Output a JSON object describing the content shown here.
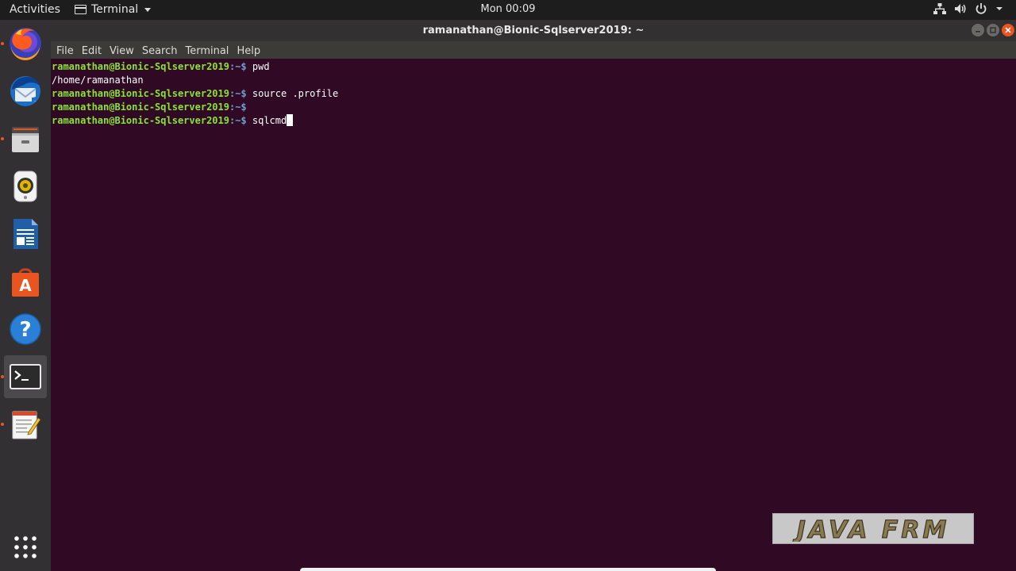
{
  "topbar": {
    "activities_label": "Activities",
    "app_name": "Terminal",
    "clock": "Mon 00:09",
    "icons": [
      "network-icon",
      "volume-icon",
      "power-icon",
      "system-menu-caret-icon"
    ]
  },
  "dock": {
    "items": [
      {
        "name": "firefox",
        "icon": "firefox-icon",
        "running": true
      },
      {
        "name": "thunderbird",
        "icon": "thunderbird-mail-icon",
        "running": false
      },
      {
        "name": "files",
        "icon": "files-cabinet-icon",
        "running": true
      },
      {
        "name": "rhythmbox",
        "icon": "rhythmbox-speaker-icon",
        "running": false
      },
      {
        "name": "libreoffice-writer",
        "icon": "writer-document-icon",
        "running": false
      },
      {
        "name": "software",
        "icon": "ubuntu-software-bag-icon",
        "running": false
      },
      {
        "name": "help",
        "icon": "help-question-icon",
        "running": false
      },
      {
        "name": "terminal",
        "icon": "terminal-icon",
        "running": true,
        "active": true
      },
      {
        "name": "text-editor",
        "icon": "text-editor-notepad-icon",
        "running": true
      }
    ],
    "show_apps_icon": "show-applications-grid-icon"
  },
  "window": {
    "title": "ramanathan@Bionic-Sqlserver2019: ~",
    "menu": [
      "File",
      "Edit",
      "View",
      "Search",
      "Terminal",
      "Help"
    ],
    "controls": [
      "minimize",
      "maximize",
      "close"
    ]
  },
  "terminal": {
    "lines": [
      {
        "prompt": "ramanathan@Bionic-Sqlserver2019",
        "path": ":~$",
        "command": " pwd"
      },
      {
        "output": "/home/ramanathan"
      },
      {
        "prompt": "ramanathan@Bionic-Sqlserver2019",
        "path": ":~$",
        "command": " source .profile"
      },
      {
        "prompt": "ramanathan@Bionic-Sqlserver2019",
        "path": ":~$",
        "command": ""
      },
      {
        "prompt": "ramanathan@Bionic-Sqlserver2019",
        "path": ":~$",
        "command": " sqlcmd",
        "cursor": true
      }
    ],
    "colors": {
      "background": "#300a24",
      "prompt": "#8ae234",
      "text": "#ffffff"
    }
  },
  "watermark": {
    "text": "JAVA FRM"
  },
  "colors": {
    "accent": "#e95420",
    "topbar": "#1d1d1d",
    "dock": "#333033"
  }
}
